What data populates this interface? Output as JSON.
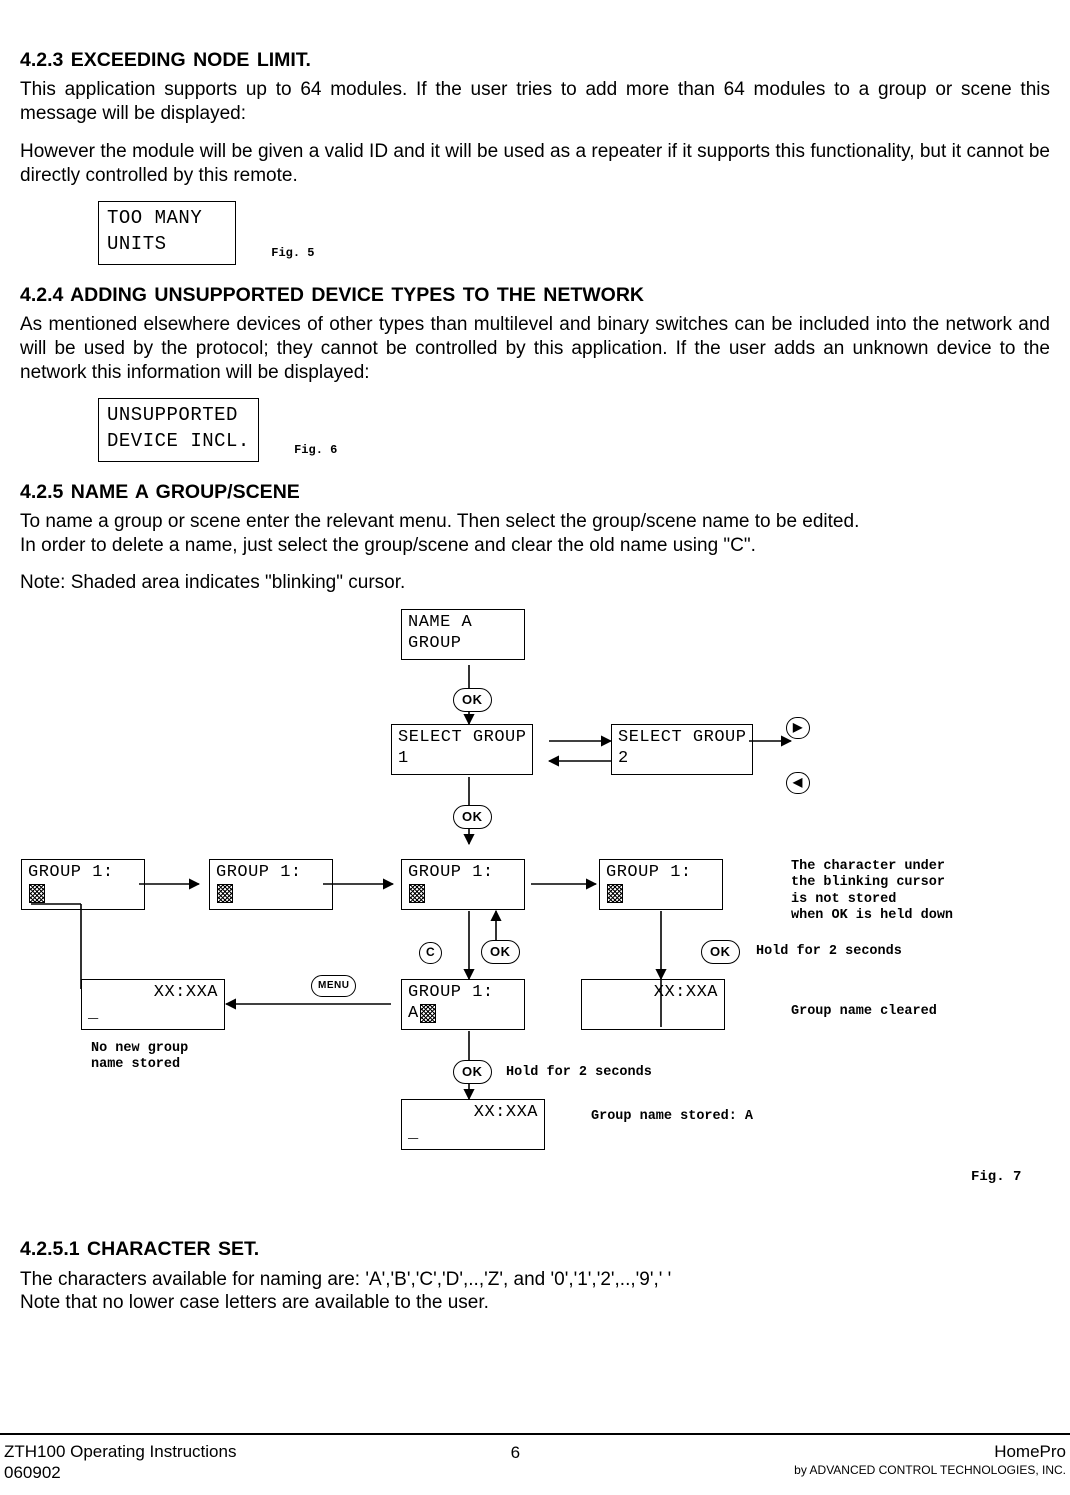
{
  "section_423": {
    "heading": "4.2.3  EXCEEDING NODE LIMIT.",
    "p1": "This application supports up to 64 modules. If the user tries to add more than 64 modules to a group or scene this message will be displayed:",
    "p2": "However the module will be given a valid ID and it will be used as a repeater if it supports this functionality, but it cannot be directly controlled by this remote.",
    "lcd": {
      "line1": "TOO MANY",
      "line2": "UNITS"
    },
    "fig": "Fig. 5"
  },
  "section_424": {
    "heading": "4.2.4  ADDING  UNSUPPORTED  DEVICE  TYPES  TO  THE  NETWORK",
    "p1": "As mentioned elsewhere devices of other types than multilevel and binary switches can be included into the network and will be used by the protocol; they cannot be controlled by this application. If the user adds an unknown device to the network this information will be displayed:",
    "lcd": {
      "line1": "UNSUPPORTED",
      "line2": "DEVICE INCL."
    },
    "fig": "Fig. 6"
  },
  "section_425": {
    "heading": "4.2.5  NAME  A  GROUP/SCENE",
    "p1": "To name a group or scene enter the relevant menu. Then select the group/scene name to be edited.\nIn order to delete a name, just select the group/scene and clear the old name using \"C\".",
    "note": "Note:  Shaded area indicates \"blinking\" cursor.",
    "fig": "Fig. 7",
    "flow": {
      "nameGroup": {
        "l1": "NAME A",
        "l2": "GROUP"
      },
      "selectGroup1": {
        "l1": "SELECT GROUP",
        "l2": "1"
      },
      "selectGroup2": {
        "l1": "SELECT GROUP",
        "l2": "2"
      },
      "group1a": {
        "l1": "GROUP 1:"
      },
      "group1b": {
        "l1": "GROUP 1:"
      },
      "group1c": {
        "l1": "GROUP 1:"
      },
      "group1d": {
        "l1": "GROUP 1:"
      },
      "group1A": {
        "l1": "GROUP 1:",
        "l2": "A"
      },
      "clock1": {
        "l1": "XX:XXA",
        "l2": "_"
      },
      "clock2": {
        "l1": "XX:XXA"
      },
      "clock3": {
        "l1": "XX:XXA",
        "l2": "_"
      },
      "annotRight1": "The character under\nthe blinking cursor\nis not stored\nwhen OK is held down",
      "annotRight2": "Hold for 2 seconds",
      "annotRight3": "Group name cleared",
      "annotBottom1": "Hold for 2 seconds",
      "annotBottom2": "Group name stored: A",
      "annotLeft": "No new group\nname stored",
      "btn_ok": "OK",
      "btn_c": "C",
      "btn_menu": "MENU",
      "btn_right": "▶",
      "btn_left": "◀"
    }
  },
  "section_4251": {
    "heading": "4.2.5.1  CHARACTER  SET.",
    "p1": "The characters available for naming are:  'A','B','C','D',..,'Z', and '0','1','2',..,'9',' '\nNote that no lower case letters are available to the user."
  },
  "footer": {
    "left1": "ZTH100 Operating Instructions",
    "left2": "060902",
    "page": "6",
    "right1": "HomePro",
    "right2": "by ADVANCED CONTROL TECHNOLOGIES, INC."
  }
}
